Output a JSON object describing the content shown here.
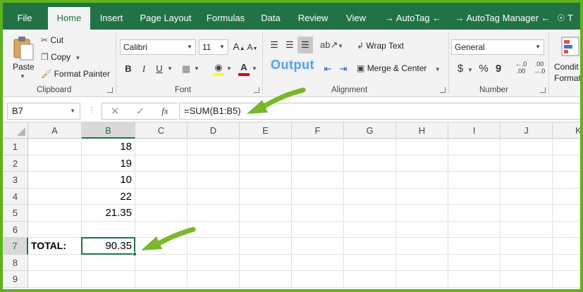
{
  "tabs": [
    {
      "label": "File",
      "active": false
    },
    {
      "label": "Home",
      "active": true
    },
    {
      "label": "Insert",
      "active": false
    },
    {
      "label": "Page Layout",
      "active": false
    },
    {
      "label": "Formulas",
      "active": false
    },
    {
      "label": "Data",
      "active": false
    },
    {
      "label": "Review",
      "active": false
    },
    {
      "label": "View",
      "active": false
    },
    {
      "label": "→ AutoTag ←",
      "active": false
    },
    {
      "label": "→ AutoTag Manager ←",
      "active": false
    },
    {
      "label": "T",
      "active": false
    }
  ],
  "clipboard": {
    "paste": "Paste",
    "cut": "Cut",
    "copy": "Copy",
    "format_painter": "Format Painter",
    "label": "Clipboard"
  },
  "font": {
    "name": "Calibri",
    "size": "11",
    "bold": "B",
    "italic": "I",
    "underline": "U",
    "label": "Font"
  },
  "alignment": {
    "wrap_text": "Wrap Text",
    "merge_center": "Merge & Center",
    "label": "Alignment"
  },
  "number": {
    "format": "General",
    "currency": "$",
    "percent": "%",
    "comma": "9",
    "label": "Number"
  },
  "styles": {
    "conditional_1": "Condit",
    "conditional_2": "Format"
  },
  "annotation": {
    "output": "Output"
  },
  "formula_bar": {
    "name_box": "B7",
    "formula": "=SUM(B1:B5)",
    "fx": "fx"
  },
  "grid": {
    "columns": [
      "A",
      "B",
      "C",
      "D",
      "E",
      "F",
      "G",
      "H",
      "I",
      "J",
      "K"
    ],
    "selected_col": "B",
    "rows": [
      {
        "n": "1",
        "a": "",
        "b": "18"
      },
      {
        "n": "2",
        "a": "",
        "b": "19"
      },
      {
        "n": "3",
        "a": "",
        "b": "10"
      },
      {
        "n": "4",
        "a": "",
        "b": "22"
      },
      {
        "n": "5",
        "a": "",
        "b": "21.35"
      },
      {
        "n": "6",
        "a": "",
        "b": ""
      },
      {
        "n": "7",
        "a": "TOTAL:",
        "b": "90.35"
      },
      {
        "n": "8",
        "a": "",
        "b": ""
      },
      {
        "n": "9",
        "a": "",
        "b": ""
      }
    ],
    "selected_row": "7"
  },
  "colors": {
    "excel_green": "#217346",
    "frame_green": "#5fb21f",
    "arrow_green": "#78b82a",
    "font_color_red": "#e00000",
    "highlight_yellow": "#ffff00"
  }
}
